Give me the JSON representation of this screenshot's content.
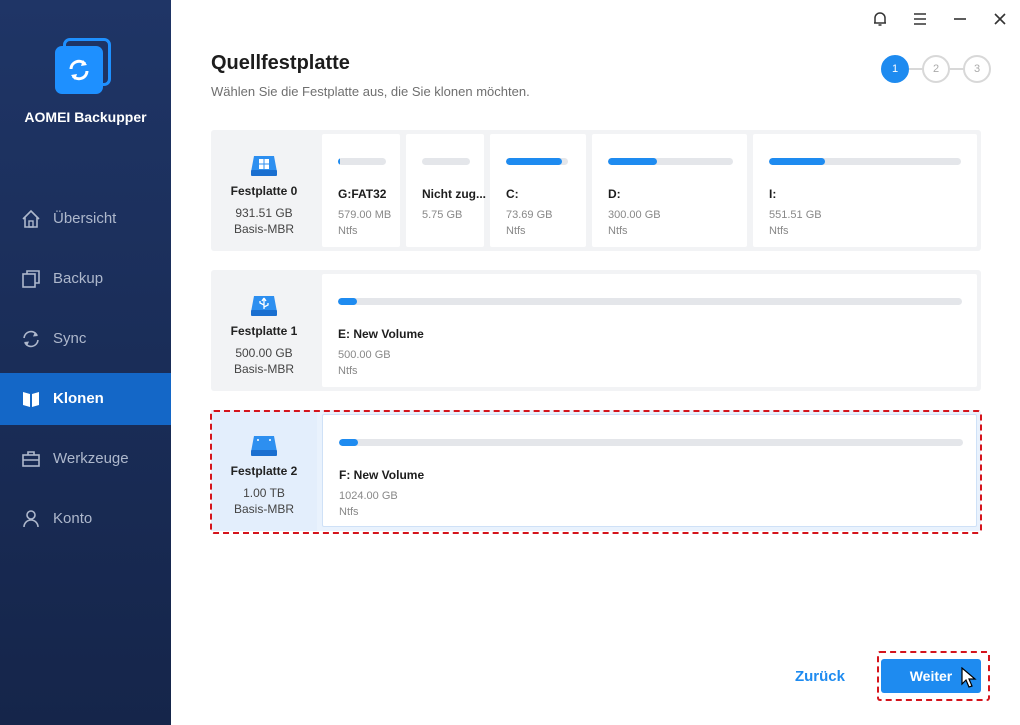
{
  "app": {
    "name": "AOMEI Backupper"
  },
  "sidebar": {
    "items": [
      {
        "label": "Übersicht",
        "icon": "home-icon"
      },
      {
        "label": "Backup",
        "icon": "backup-icon"
      },
      {
        "label": "Sync",
        "icon": "sync-icon"
      },
      {
        "label": "Klonen",
        "icon": "clone-icon",
        "active": true
      },
      {
        "label": "Werkzeuge",
        "icon": "toolbox-icon"
      },
      {
        "label": "Konto",
        "icon": "user-icon"
      }
    ]
  },
  "header": {
    "title": "Quellfestplatte",
    "subtitle": "Wählen Sie die Festplatte aus, die Sie klonen möchten."
  },
  "steps": [
    {
      "label": "1",
      "active": true
    },
    {
      "label": "2",
      "active": false
    },
    {
      "label": "3",
      "active": false
    }
  ],
  "disks": [
    {
      "name": "Festplatte 0",
      "size": "931.51 GB",
      "type": "Basis-MBR",
      "icon": "windows-disk-icon",
      "partitions": [
        {
          "name": "G:FAT32",
          "size": "579.00 MB",
          "fs": "Ntfs",
          "used_fraction": 0.05
        },
        {
          "name": "Nicht zug...",
          "size": "5.75 GB",
          "fs": "",
          "used_fraction": 0.0
        },
        {
          "name": "C:",
          "size": "73.69 GB",
          "fs": "Ntfs",
          "used_fraction": 0.9
        },
        {
          "name": "D:",
          "size": "300.00 GB",
          "fs": "Ntfs",
          "used_fraction": 0.39
        },
        {
          "name": "I:",
          "size": "551.51 GB",
          "fs": "Ntfs",
          "used_fraction": 0.29
        }
      ]
    },
    {
      "name": "Festplatte 1",
      "size": "500.00 GB",
      "type": "Basis-MBR",
      "icon": "usb-disk-icon",
      "partitions": [
        {
          "name": "E: New Volume",
          "size": "500.00 GB",
          "fs": "Ntfs",
          "used_fraction": 0.005
        }
      ]
    },
    {
      "name": "Festplatte 2",
      "size": "1.00 TB",
      "type": "Basis-MBR",
      "icon": "disk-icon",
      "selected": true,
      "partitions": [
        {
          "name": "F: New Volume",
          "size": "1024.00 GB",
          "fs": "Ntfs",
          "used_fraction": 0.005
        }
      ]
    }
  ],
  "footer": {
    "back_label": "Zurück",
    "next_label": "Weiter"
  },
  "colors": {
    "accent": "#1e8bf0",
    "sidebar": "#1f3566",
    "highlight": "#d5141c"
  }
}
